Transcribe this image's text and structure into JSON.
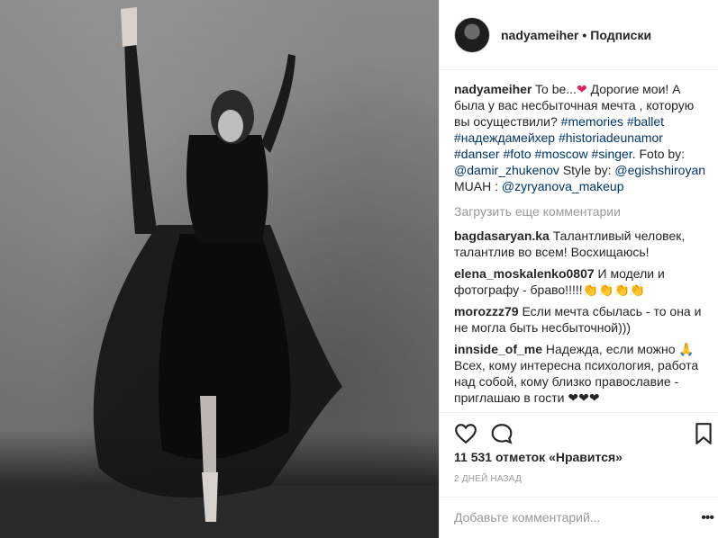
{
  "post": {
    "header": {
      "username": "nadyameiher",
      "separator": "•",
      "follow_label": "Подписки"
    },
    "caption": {
      "username": "nadyameiher",
      "text_start": "To be...",
      "heart": "❤",
      "text_body": "Дорогие мои! А была у вас несбыточная мечта , которую вы осуществили?",
      "hashtags": [
        "#memories",
        "#ballet",
        "#надеждамейхер",
        "#historiadeunamor",
        "#danser",
        "#foto",
        "#moscow",
        "#singer"
      ],
      "foto_by": ". Foto by:",
      "photographer": "@damir_zhukenov",
      "style_by": "Style by:",
      "stylist": "@egishshiroyan",
      "muah": "MUAH :",
      "makeup": "@zyryanova_makeup"
    },
    "load_more": "Загрузить еще комментарии",
    "comments": [
      {
        "user": "bagdasaryan.ka",
        "text": "Талантливый человек, талантлив во всем! Восхищаюсь!"
      },
      {
        "user": "elena_moskalenko0807",
        "text": "И модели и фотографу - браво!!!!!👏👏👏👏"
      },
      {
        "user": "morozzz79",
        "text": "Если мечта сбылась - то она и не могла быть несбыточной)))"
      },
      {
        "user": "innside_of_me",
        "text": "Надежда, если можно 🙏 Всех, кому интересна психология, работа над собой, кому близко православие - приглашаю в гости ❤❤❤"
      }
    ],
    "likes": "11 531 отметок «Нравится»",
    "date": "2 ДНЕЙ НАЗАД",
    "add_comment_placeholder": "Добавьте комментарий...",
    "options_label": "•••"
  },
  "icons": {
    "like": "heart-outline-icon",
    "comment": "speech-bubble-icon",
    "save": "bookmark-icon",
    "options": "ellipsis-icon"
  }
}
